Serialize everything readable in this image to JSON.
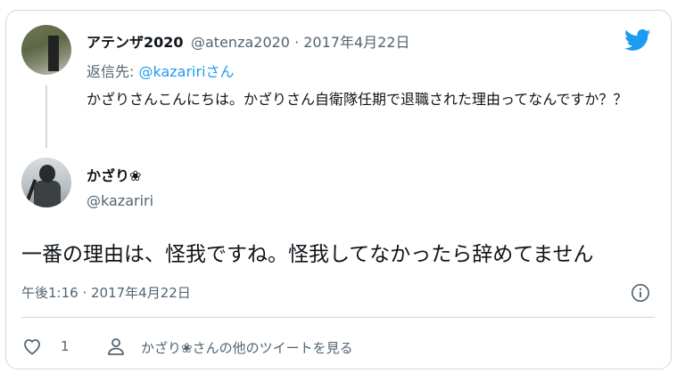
{
  "reply_tweet": {
    "display_name": "アテンザ2020",
    "handle_and_date": "@atenza2020 · 2017年4月22日",
    "reply_prefix": "返信先: ",
    "reply_to": "@kazaririさん",
    "text": "かざりさんこんにちは。かざりさん自衛隊任期で退職された理由ってなんですか？？"
  },
  "main_tweet": {
    "display_name": "かざり❀",
    "handle": "@kazariri",
    "text": "一番の理由は、怪我ですね。怪我してなかったら辞めてません",
    "timestamp": "午後1:16 · 2017年4月22日"
  },
  "actions": {
    "like_count": "1",
    "more_tweets": "かざり❀さんの他のツイートを見る"
  },
  "icons": {
    "brand": "twitter-bird-icon",
    "info": "info-icon",
    "like": "heart-icon",
    "profile": "person-icon"
  },
  "colors": {
    "brand": "#1d9bf0",
    "text": "#0f1419",
    "secondary": "#536471",
    "border": "#cfd9de"
  }
}
